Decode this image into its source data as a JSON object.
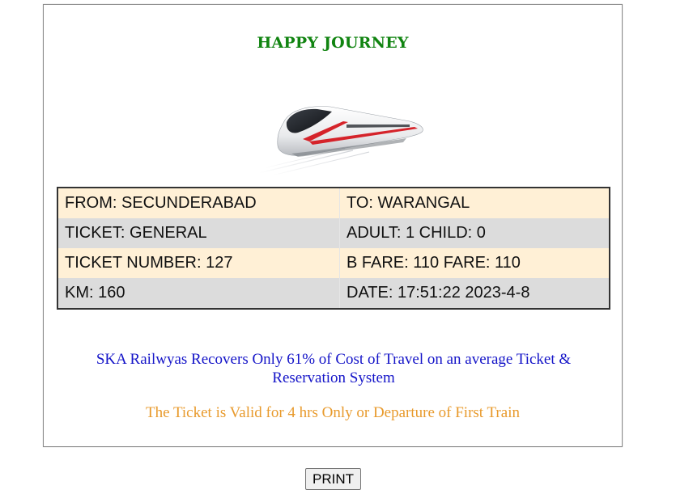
{
  "ticket": {
    "title": "HAPPY JOURNEY",
    "image": {
      "icon": "high-speed-train-image"
    },
    "rows": [
      {
        "left": "FROM: SECUNDERABAD",
        "right": "TO: WARANGAL"
      },
      {
        "left": "TICKET: GENERAL",
        "right": "ADULT: 1 CHILD: 0"
      },
      {
        "left": "TICKET NUMBER: 127",
        "right": "B FARE: 110 FARE: 110"
      },
      {
        "left": "KM: 160",
        "right": "DATE: 17:51:22 2023-4-8"
      }
    ],
    "notice": "SKA Railwyas Recovers Only 61% of Cost of Travel on an average Ticket & Reservation System",
    "validity": "The Ticket is Valid for 4 hrs Only or Departure of First Train"
  },
  "actions": {
    "print_label": "PRINT"
  },
  "colors": {
    "title": "#118411",
    "notice": "#1414c8",
    "validity": "#e89a2c",
    "row_odd": "#fff0d6",
    "row_even": "#dcdcdc",
    "train_accent": "#d5232a"
  }
}
